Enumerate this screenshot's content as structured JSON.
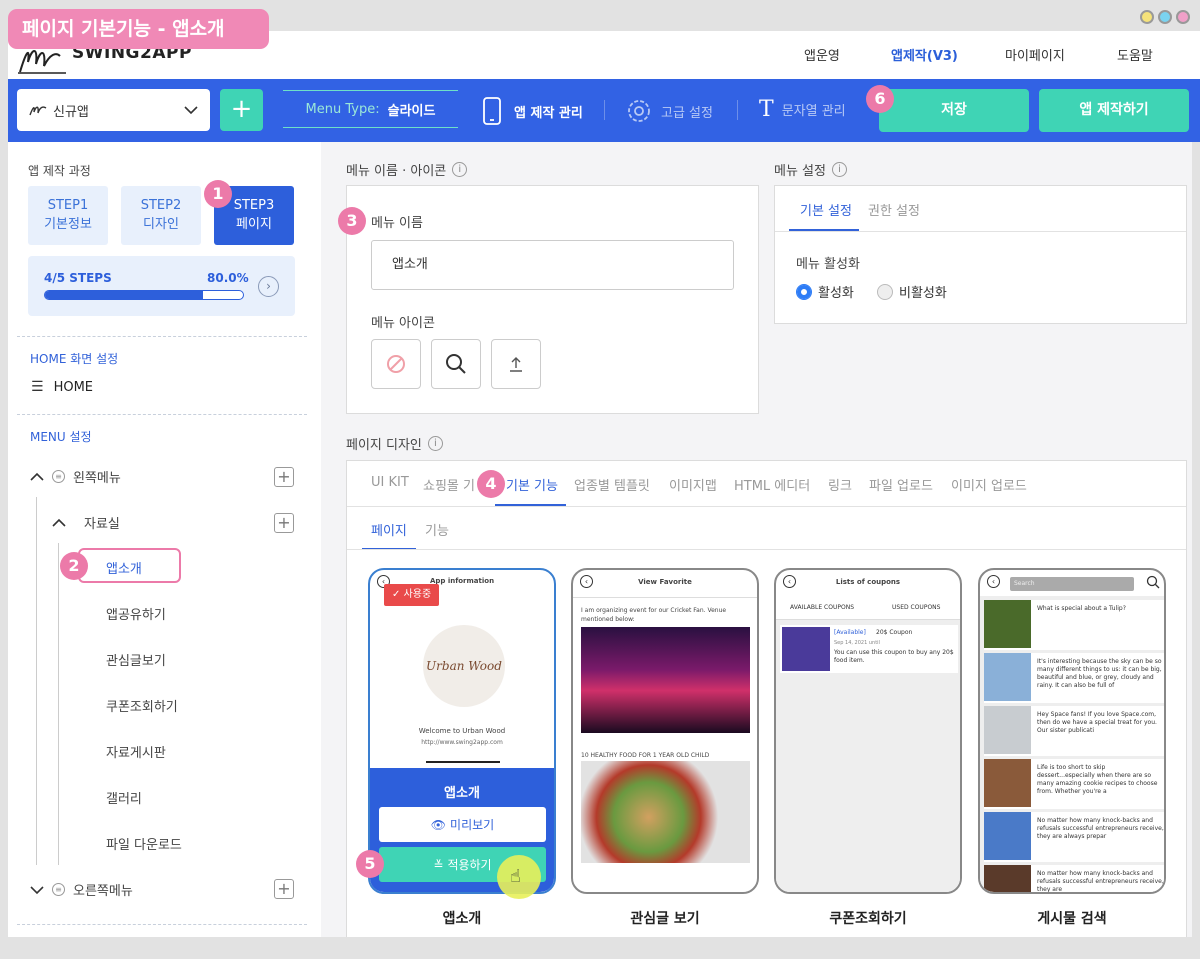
{
  "title_tag": "페이지 기본기능 - 앱소개",
  "logo": {
    "text": "SWING2APP"
  },
  "nav": [
    "앱운영",
    "앱제작(V3)",
    "마이페이지",
    "도움말"
  ],
  "toolbar": {
    "app_name": "신규앱",
    "menu_type_label": "Menu Type:",
    "menu_type_value": "슬라이드",
    "app_manage": "앱 제작 관리",
    "advanced": "고급 설정",
    "strings": "문자열 관리",
    "save": "저장",
    "make_app": "앱 제작하기"
  },
  "markers": [
    "1",
    "2",
    "3",
    "4",
    "5",
    "6"
  ],
  "sidebar": {
    "process_title": "앱 제작 과정",
    "steps": [
      {
        "line1": "STEP1",
        "line2": "기본정보"
      },
      {
        "line1": "STEP2",
        "line2": "디자인"
      },
      {
        "line1": "STEP3",
        "line2": "페이지"
      }
    ],
    "progress_label": "4/5 STEPS",
    "progress_value": "80.0%",
    "progress_fraction": 0.8,
    "home_title": "HOME 화면 설정",
    "home_item": "HOME",
    "menu_title": "MENU 설정",
    "left_menu": "왼쪽메뉴",
    "folder": "자료실",
    "items": [
      "앱소개",
      "앱공유하기",
      "관심글보기",
      "쿠폰조회하기",
      "자료게시판",
      "갤러리",
      "파일 다운로드"
    ],
    "right_menu": "오른쪽메뉴"
  },
  "menu_name_section": {
    "title": "메뉴 이름 · 아이콘",
    "name_label": "메뉴 이름",
    "name_value": "앱소개",
    "icon_label": "메뉴 아이콘"
  },
  "menu_settings": {
    "title": "메뉴 설정",
    "tabs": [
      "기본 설정",
      "권한 설정"
    ],
    "activation_label": "메뉴 활성화",
    "options": [
      "활성화",
      "비활성화"
    ]
  },
  "page_design": {
    "title": "페이지 디자인",
    "tabs": [
      "UI KIT",
      "쇼핑몰 기",
      "기본 기능",
      "업종별 템플릿",
      "이미지맵",
      "HTML 에디터",
      "링크",
      "파일 업로드",
      "이미지 업로드"
    ],
    "subtabs": [
      "페이지",
      "기능"
    ]
  },
  "cards": [
    {
      "caption": "앱소개",
      "header": "App information",
      "badge": "사용중",
      "logo_text": "Urban Wood",
      "welcome": "Welcome to Urban Wood",
      "url": "http://www.swing2app.com",
      "overlay_title": "앱소개",
      "preview": "미리보기",
      "apply": "적용하기"
    },
    {
      "caption": "관심글 보기",
      "header": "View Favorite",
      "text1": "I am organizing event for our Cricket Fan. Venue mentioned below:",
      "text2": "10 HEALTHY FOOD FOR 1 YEAR OLD CHILD"
    },
    {
      "caption": "쿠폰조회하기",
      "header": "Lists of coupons",
      "tab1": "AVAILABLE COUPONS",
      "tab2": "USED COUPONS",
      "coupon_status": "[Available]",
      "coupon_title": "20$ Coupon",
      "coupon_date": "Sep 14, 2021 until",
      "coupon_desc": "You can use this coupon to buy any 20$ food item."
    },
    {
      "caption": "게시물 검색",
      "search": "Search",
      "posts": [
        "What is special about a Tulip?",
        "It's interesting because the sky can be so many different things to us: it can be big, beautiful and blue, or grey, cloudy and rainy. It can also be full of",
        "Hey Space fans! If you love Space.com, then do we have a special treat for you. Our sister publicati",
        "Life is too short to skip dessert...especially when there are so many amazing cookie recipes to choose from. Whether you're a",
        "No matter how many knock-backs and refusals successful entrepreneurs receive, they are always prepar",
        "No matter how many knock-backs and refusals successful entrepreneurs receive, they are"
      ]
    }
  ],
  "colors": {
    "primary": "#3262e4",
    "accent": "#3fd4b5",
    "marker": "#ec7aa9"
  }
}
